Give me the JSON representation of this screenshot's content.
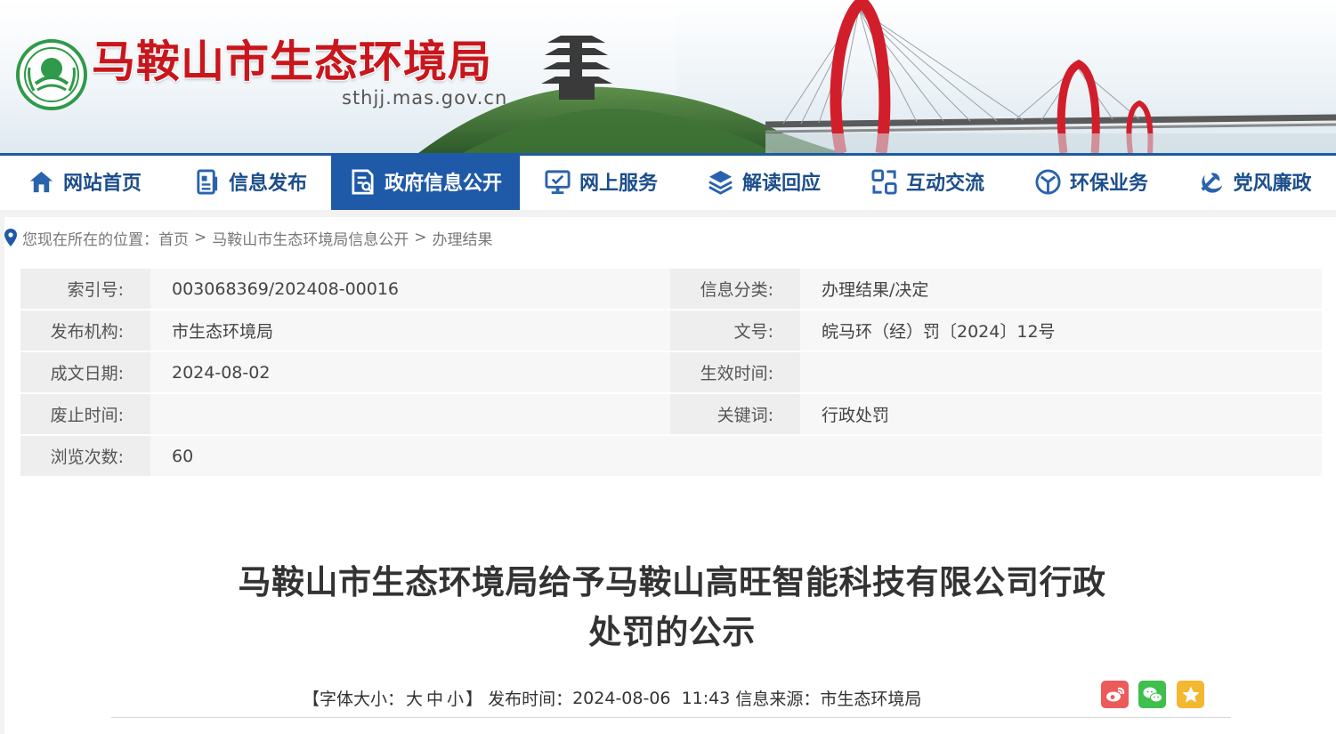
{
  "header": {
    "site_title": "马鞍山市生态环境局",
    "site_domain": "sthjj.mas.gov.cn"
  },
  "nav": {
    "items": [
      {
        "label": "网站首页",
        "icon": "home-icon"
      },
      {
        "label": "信息发布",
        "icon": "document-icon"
      },
      {
        "label": "政府信息公开",
        "icon": "open-info-icon",
        "active": true
      },
      {
        "label": "网上服务",
        "icon": "monitor-icon"
      },
      {
        "label": "解读回应",
        "icon": "layers-icon"
      },
      {
        "label": "互动交流",
        "icon": "exchange-icon"
      },
      {
        "label": "环保业务",
        "icon": "eco-icon"
      },
      {
        "label": "党风廉政",
        "icon": "party-icon"
      }
    ]
  },
  "breadcrumb": {
    "prefix": "您现在所在的位置：",
    "items": [
      "首页",
      "马鞍山市生态环境局信息公开",
      "办理结果"
    ],
    "separator": ">"
  },
  "meta": {
    "rows": [
      {
        "k1": "索引号:",
        "v1": "003068369/202408-00016",
        "k2": "信息分类:",
        "v2": "办理结果/决定"
      },
      {
        "k1": "发布机构:",
        "v1": "市生态环境局",
        "k2": "文号:",
        "v2": "皖马环（经）罚〔2024〕12号"
      },
      {
        "k1": "成文日期:",
        "v1": "2024-08-02",
        "k2": "生效时间:",
        "v2": ""
      },
      {
        "k1": "废止时间:",
        "v1": "",
        "k2": "关键词:",
        "v2": "行政处罚"
      },
      {
        "k1": "浏览次数:",
        "v1": "60"
      }
    ]
  },
  "article": {
    "title_line1": "马鞍山市生态环境局给予马鞍山高旺智能科技有限公司行政",
    "title_line2": "处罚的公示",
    "font_size_label": "【字体大小：",
    "font_large": "大",
    "font_medium": "中",
    "font_small": "小",
    "font_size_close": "】",
    "publish_label": "发布时间：",
    "publish_time": "2024-08-06  11:43",
    "source_label": "信息来源：",
    "source": "市生态环境局"
  },
  "share": {
    "icons": [
      "weibo-icon",
      "wechat-icon",
      "favorite-icon"
    ],
    "colors": {
      "weibo": "#ec5a5a",
      "wechat": "#3fbf4c",
      "favorite": "#f4b731"
    }
  },
  "colors": {
    "brand_red": "#c8161d",
    "nav_blue": "#1f5aa8",
    "nav_text": "#1c4e8c"
  }
}
